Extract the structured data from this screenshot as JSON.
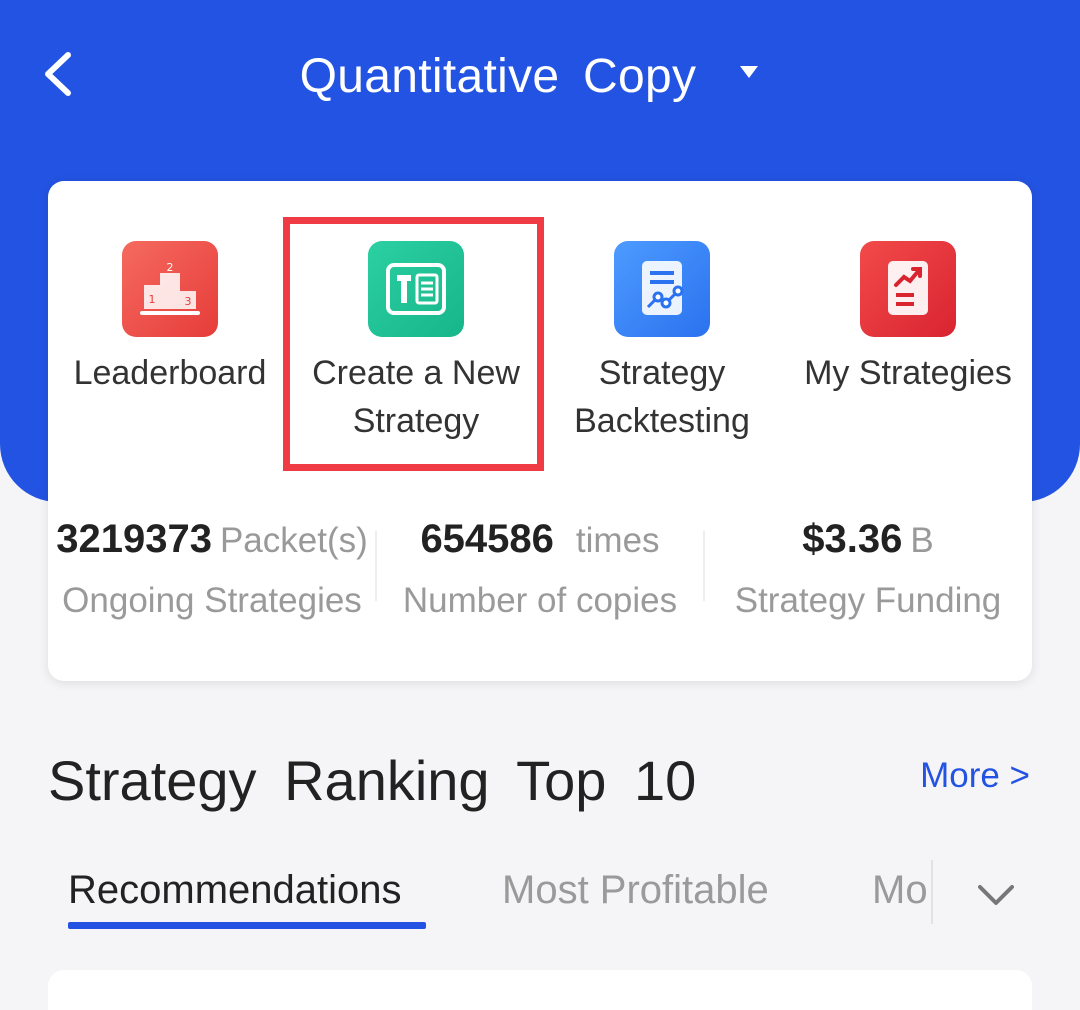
{
  "header": {
    "title": "Quantitative  Copy",
    "background_color": "#2353e2",
    "back_icon": "chevron-left-icon",
    "dropdown_icon": "caret-down-icon"
  },
  "features": [
    {
      "label": "Leaderboard",
      "icon": "podium-icon",
      "color": "#ef4e46"
    },
    {
      "label": "Create a New Strategy",
      "icon": "tool-document-icon",
      "color": "#1fbd93",
      "highlighted": true
    },
    {
      "label": "Strategy Backtesting",
      "icon": "backtest-document-icon",
      "color": "#3585f5"
    },
    {
      "label": "My Strategies",
      "icon": "chart-document-icon",
      "color": "#e8333b"
    }
  ],
  "stats": [
    {
      "value": "3219373",
      "unit": "Packet(s)",
      "label": "Ongoing Strategies"
    },
    {
      "value": "654586",
      "unit": "times",
      "label": "Number of copies"
    },
    {
      "value": "$3.36",
      "unit": "B",
      "label": "Strategy Funding"
    }
  ],
  "ranking": {
    "title": "Strategy  Ranking  Top  10",
    "more_label": "More >",
    "tabs": [
      {
        "label": "Recommendations",
        "active": true
      },
      {
        "label": "Most Profitable",
        "active": false
      },
      {
        "label": "Mo",
        "active": false
      }
    ],
    "expand_icon": "chevron-down-icon"
  },
  "colors": {
    "accent": "#2353e2",
    "highlight_border": "#ef3b43",
    "background": "#f5f5f7"
  }
}
